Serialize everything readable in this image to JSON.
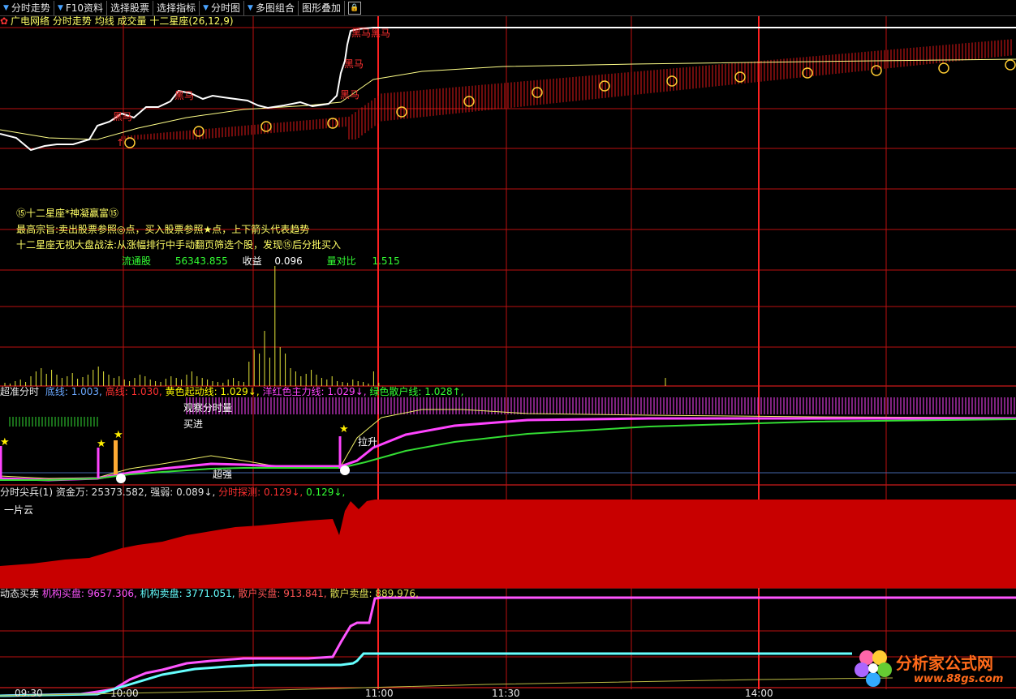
{
  "toolbar": {
    "items": [
      {
        "label": "分时走势",
        "has_arrow": true
      },
      {
        "label": "F10资料",
        "has_arrow": true
      },
      {
        "label": "选择股票",
        "has_arrow": false
      },
      {
        "label": "选择指标",
        "has_arrow": false
      },
      {
        "label": "分时图",
        "has_arrow": true
      },
      {
        "label": "多图组合",
        "has_arrow": true
      },
      {
        "label": "图形叠加",
        "has_arrow": false
      }
    ]
  },
  "main_panel": {
    "stock_name": "广电网络",
    "chart_name": "分时走势",
    "avg_label": "均线",
    "vol_label": "成交量",
    "indicator_label": "十二星座(26,12,9)",
    "marker_label": "黑马",
    "info_line1": "⑮十二星座*神凝赢富⑮",
    "info_line2": "最高宗旨:卖出股票参照◎点，买入股票参照★点，上下箭头代表趋势",
    "info_line3": "十二星座无视大盘战法:从涨幅排行中手动翻页筛选个股，发现⑮后分批买入",
    "float_label": "流通股",
    "float_value": "56343.855",
    "eps_label": "收益",
    "eps_value": "0.096",
    "vr_label": "量对比",
    "vr_value": "1.515"
  },
  "panel2": {
    "title": "超准分时",
    "items": [
      {
        "text": "底线: 1.003,",
        "color": "#6aa8ff"
      },
      {
        "text": "高线: 1.030,",
        "color": "#ff3030"
      },
      {
        "text": "黄色起动线: 1.029↓,",
        "color": "#ffff00"
      },
      {
        "text": "洋红色主力线: 1.029↓,",
        "color": "#ff44ff"
      },
      {
        "text": "绿色散户线: 1.028↑,",
        "color": "#33ff33"
      }
    ],
    "observe": "观察分时量",
    "buy": "买进",
    "strong": "超强",
    "rise": "拉升"
  },
  "panel3": {
    "title": "分时尖兵(1)",
    "items": [
      {
        "text": "资金万: 25373.582,",
        "color": "#e0e0e0"
      },
      {
        "text": "强弱: 0.089↓,",
        "color": "#e0e0e0"
      },
      {
        "text": "分时探测: 0.129↓,",
        "color": "#ff3030"
      },
      {
        "text": "0.129↓,",
        "color": "#33ff33"
      }
    ],
    "cloud": "一片云"
  },
  "panel4": {
    "title": "动态买卖",
    "items": [
      {
        "text": "机构买盘: 9657.306,",
        "color": "#ff55ff"
      },
      {
        "text": "机构卖盘: 3771.051,",
        "color": "#66ffff"
      },
      {
        "text": "散户买盘: 913.841,",
        "color": "#ff5555"
      },
      {
        "text": "散户卖盘: 889.976,",
        "color": "#dddd55"
      }
    ]
  },
  "time_axis": [
    "09:30",
    "10:00",
    "11:00",
    "11:30",
    "14:00"
  ],
  "watermark": {
    "name": "分析家公式网",
    "url": "www.88gs.com"
  },
  "colors": {
    "grid": "#cc1010",
    "price": "#ffffff",
    "avg": "#ffff66",
    "vol": "#ffff33",
    "cloud": "#cc0000"
  }
}
